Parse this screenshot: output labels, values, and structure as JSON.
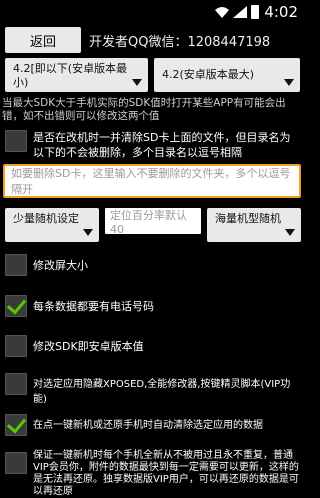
{
  "statusbar": {
    "time": "4:02"
  },
  "top": {
    "back_label": "返回",
    "dev_info": "开发者QQ微信：1208447198"
  },
  "sdk": {
    "left_spinner": "4.2[即以下(安卓版本最小)",
    "right_spinner": "4.2(安卓版本最大)",
    "note": "当最大SDK大于手机实际的SDK值时打开某些APP有可能会出错，如不出错则可以修改这两个值"
  },
  "clear_sd": {
    "label": "是否在改机时一并清除SD卡上面的文件，但目录名为以下的不会被删除，多个目录名以逗号相隔",
    "checked": false
  },
  "exclude_input": {
    "placeholder": "如要删除SD卡，这里输入不要删除的文件夹，多个以逗号隔开"
  },
  "random": {
    "left_spinner": "少量随机设定",
    "percent_placeholder": "定位百分率默认40",
    "right_spinner": "海量机型随机"
  },
  "options": [
    {
      "label": "修改屏大小",
      "checked": false
    },
    {
      "label": "每条数据都要有电话号码",
      "checked": true
    },
    {
      "label": "修改SDK即安卓版本值",
      "checked": false
    },
    {
      "label": "对选定应用隐藏XPOSED,全能修改器,按键精灵脚本(VIP功能)",
      "checked": false
    },
    {
      "label": "在点一键新机或还原手机时自动清除选定应用的数据",
      "checked": true
    },
    {
      "label": "保证一键新机时每个手机全新从不被用过且永不重复，普通VIP会员你，附件的数据最快到每一定需要可以更新，这样的是无法再还原。独享数据版VIP用户，可以再还原的数据是可以再还原",
      "checked": false
    }
  ]
}
